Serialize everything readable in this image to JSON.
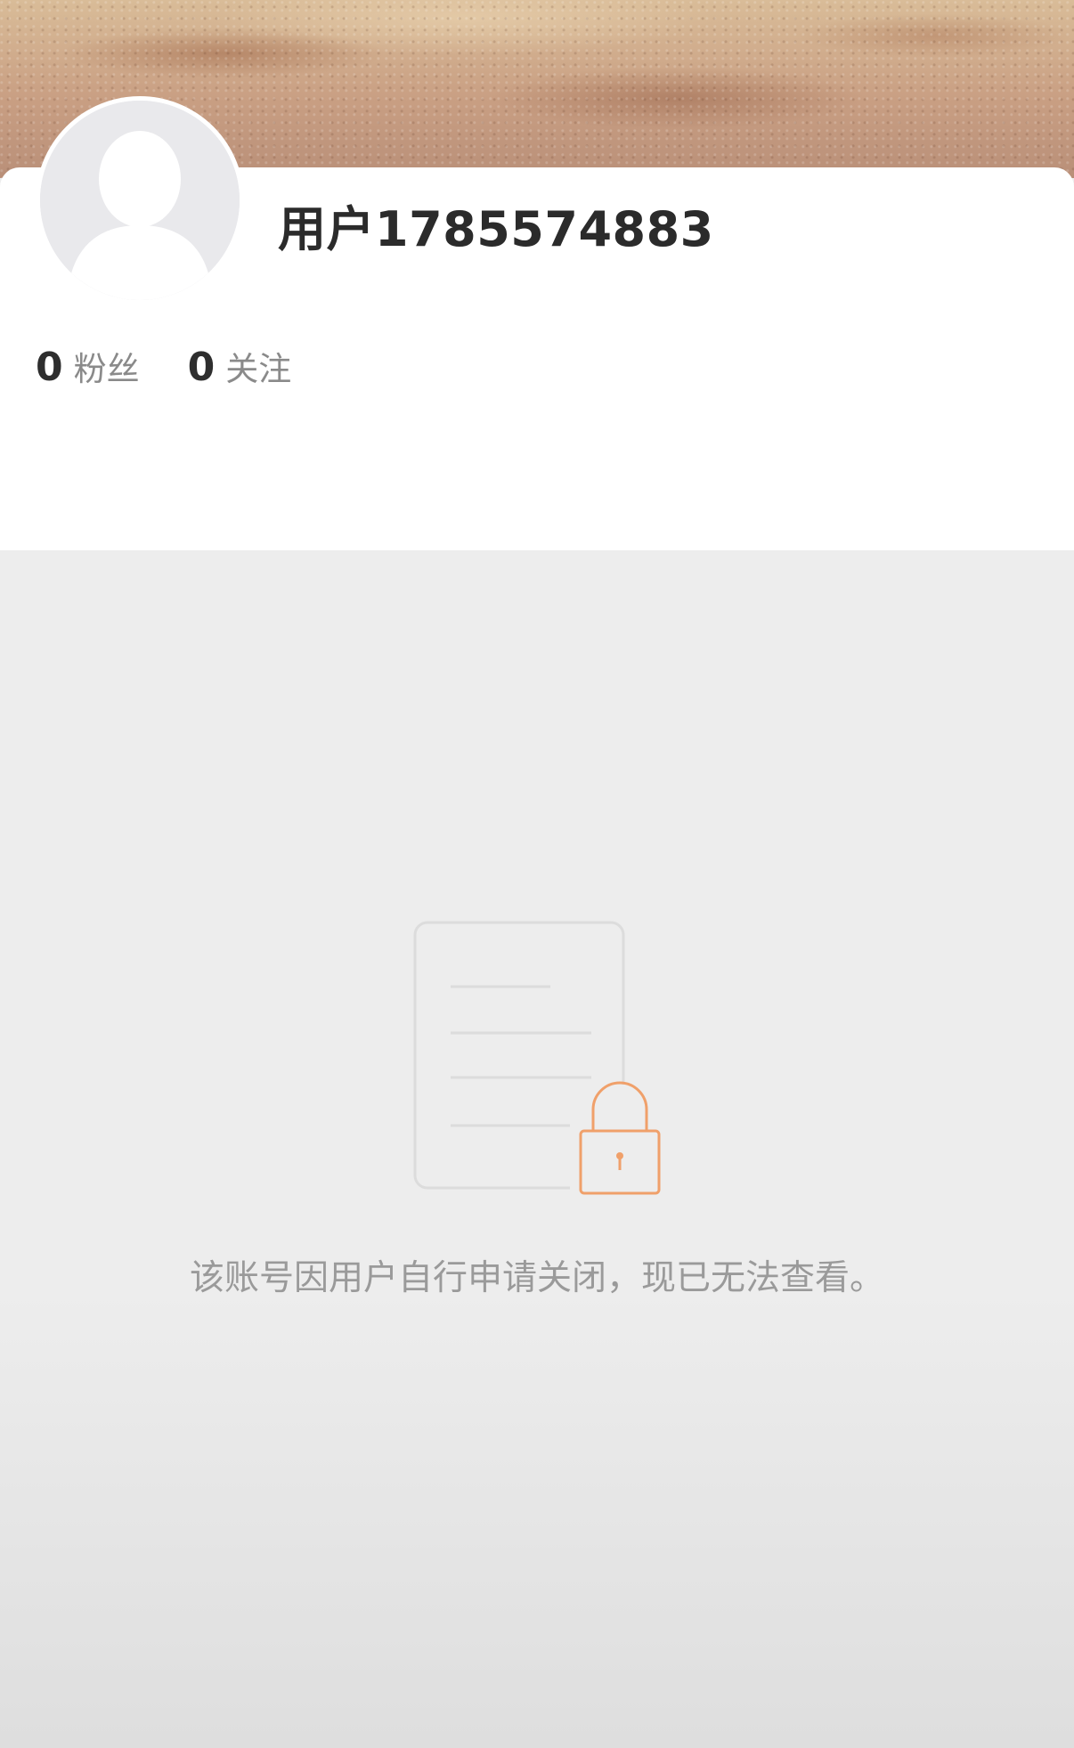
{
  "profile": {
    "username": "用户1785574883",
    "stats": [
      {
        "count": "0",
        "label": "粉丝"
      },
      {
        "count": "0",
        "label": "关注"
      }
    ]
  },
  "locked": {
    "icon": "document-lock-icon",
    "message": "该账号因用户自行申请关闭，现已无法查看。"
  },
  "colors": {
    "lock_accent": "#f0a06a",
    "document_stroke": "#dcdcdc",
    "background": "#ededed"
  }
}
